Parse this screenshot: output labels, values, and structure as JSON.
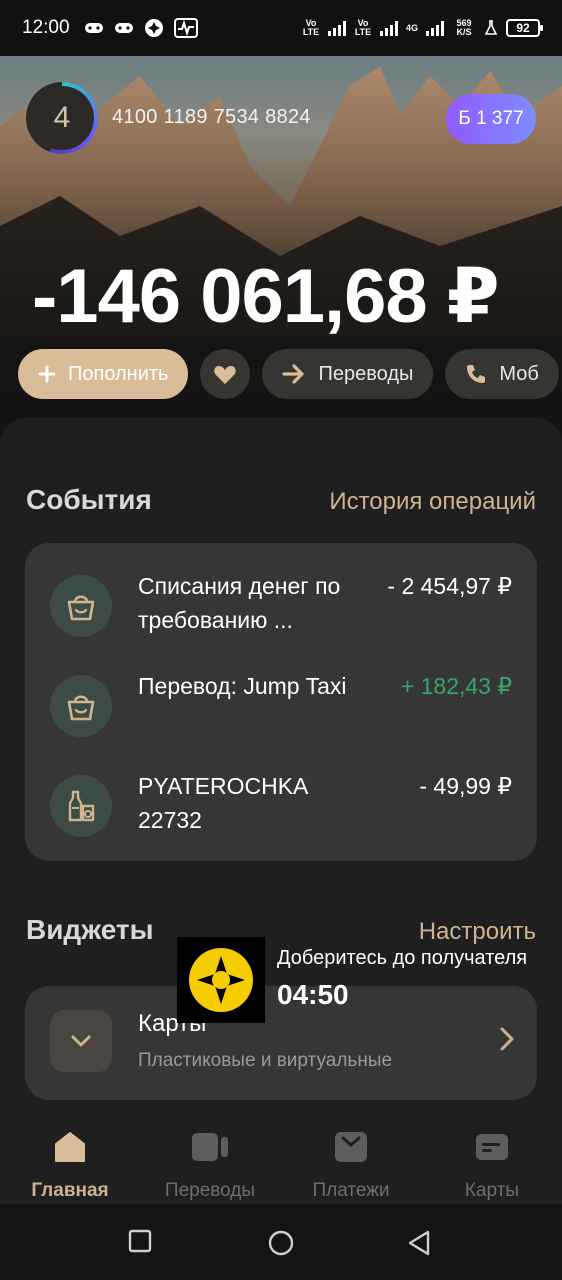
{
  "status_bar": {
    "time": "12:00",
    "net_1": "Vo LTE",
    "net_2": "Vo LTE",
    "net_3": "4G",
    "speed": "569 K/S",
    "battery": "92"
  },
  "header": {
    "level": "4",
    "account_number": "4100 1189 7534 8824",
    "bonus": "Б 1 377"
  },
  "balance": "-146 061,68 ₽",
  "actions": {
    "top_up": "Пополнить",
    "transfers": "Переводы",
    "mobile": "Моб"
  },
  "events": {
    "title": "События",
    "history_link": "История операций",
    "items": [
      {
        "title": "Списания денег по требованию ...",
        "amount": "- 2 454,97 ₽",
        "icon": "shopping-bag-icon"
      },
      {
        "title": "Перевод: Jump Taxi",
        "amount": "+ 182,43 ₽",
        "icon": "shopping-bag-icon"
      },
      {
        "title": "PYATEROCHKA 22732",
        "amount": "- 49,99 ₽",
        "icon": "bottles-icon"
      }
    ]
  },
  "widgets": {
    "title": "Виджеты",
    "configure_link": "Настроить",
    "card_title": "Карты",
    "card_subtitle": "Пластиковые и виртуальные"
  },
  "toast": {
    "text": "Доберитесь до получателя",
    "time": "04:50"
  },
  "bottom_nav": {
    "items": [
      {
        "label": "Главная",
        "icon": "home-icon"
      },
      {
        "label": "Переводы",
        "icon": "transfers-icon"
      },
      {
        "label": "Платежи",
        "icon": "payments-icon"
      },
      {
        "label": "Карты",
        "icon": "cards-icon"
      }
    ]
  },
  "colors": {
    "accent": "#cfb48f",
    "primary_button": "#d9bd98",
    "positive": "#3aa56b",
    "bonus_gradient_start": "#8f5bff",
    "bonus_gradient_end": "#7f8cff"
  }
}
